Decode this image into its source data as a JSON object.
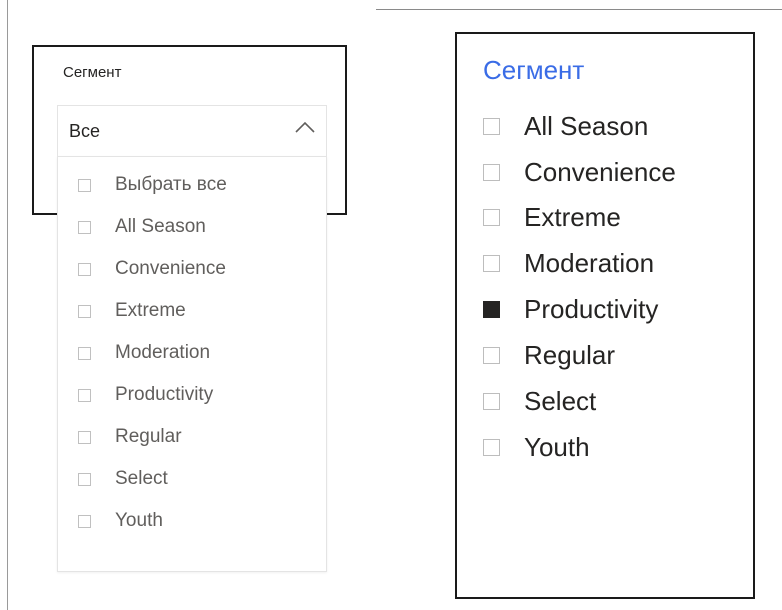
{
  "dropdown_slicer": {
    "title": "Сегмент",
    "selected_value": "Все",
    "items": [
      {
        "label": "Выбрать все",
        "checked": false
      },
      {
        "label": "All Season",
        "checked": false
      },
      {
        "label": "Convenience",
        "checked": false
      },
      {
        "label": "Extreme",
        "checked": false
      },
      {
        "label": "Moderation",
        "checked": false
      },
      {
        "label": "Productivity",
        "checked": false
      },
      {
        "label": "Regular",
        "checked": false
      },
      {
        "label": "Select",
        "checked": false
      },
      {
        "label": "Youth",
        "checked": false
      }
    ]
  },
  "list_slicer": {
    "title": "Сегмент",
    "title_color": "#3a6ce6",
    "items": [
      {
        "label": "All Season",
        "checked": false
      },
      {
        "label": "Convenience",
        "checked": false
      },
      {
        "label": "Extreme",
        "checked": false
      },
      {
        "label": "Moderation",
        "checked": false
      },
      {
        "label": "Productivity",
        "checked": true
      },
      {
        "label": "Regular",
        "checked": false
      },
      {
        "label": "Select",
        "checked": false
      },
      {
        "label": "Youth",
        "checked": false
      }
    ]
  }
}
